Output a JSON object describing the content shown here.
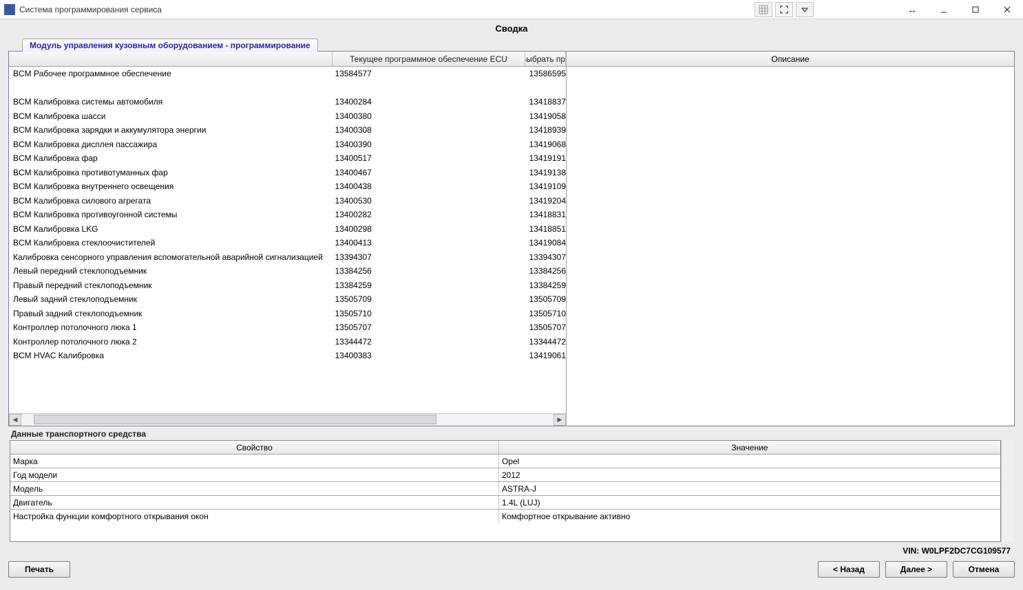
{
  "window": {
    "title": "Система программирования сервиса"
  },
  "page": {
    "summary_title": "Сводка"
  },
  "tab": {
    "label": "Модуль управления кузовным оборудованием - программирование"
  },
  "columns": {
    "blank": "",
    "current_ecu": "Текущее программное обеспечение ECU",
    "select_prog": "Выбрать про",
    "description": "Описание"
  },
  "rows": [
    {
      "name": "BCM Рабочее программное обеспечение",
      "cur": "13584577",
      "sel": "13586595"
    },
    {
      "name": "BCM Калибровка системы автомобиля",
      "cur": "13400284",
      "sel": "13418837"
    },
    {
      "name": "BCM Калибровка шасси",
      "cur": "13400380",
      "sel": "13419058"
    },
    {
      "name": "BCM Калибровка зарядки и аккумулятора энергии",
      "cur": "13400308",
      "sel": "13418939"
    },
    {
      "name": "BCM Калибровка дисплея пассажира",
      "cur": "13400390",
      "sel": "13419068"
    },
    {
      "name": "BCM Калибровка фар",
      "cur": "13400517",
      "sel": "13419191"
    },
    {
      "name": "BCM Калибровка противотуманных фар",
      "cur": "13400467",
      "sel": "13419138"
    },
    {
      "name": "BCM Калибровка внутреннего освещения",
      "cur": "13400438",
      "sel": "13419109"
    },
    {
      "name": "BCM Калибровка силового агрегата",
      "cur": "13400530",
      "sel": "13419204"
    },
    {
      "name": "BCM Калибровка противоугонной системы",
      "cur": "13400282",
      "sel": "13418831"
    },
    {
      "name": "BCM Калибровка LKG",
      "cur": "13400298",
      "sel": "13418851"
    },
    {
      "name": "BCM Калибровка стеклоочистителей",
      "cur": "13400413",
      "sel": "13419084"
    },
    {
      "name": "Калибровка сенсорного управления вспомогательной аварийной сигнализацией",
      "cur": "13394307",
      "sel": "13394307"
    },
    {
      "name": "Левый передний стеклоподъемник",
      "cur": "13384256",
      "sel": "13384256"
    },
    {
      "name": "Правый передний стеклоподъемник",
      "cur": "13384259",
      "sel": "13384259"
    },
    {
      "name": "Левый задний стеклоподъемник",
      "cur": "13505709",
      "sel": "13505709"
    },
    {
      "name": "Правый задний стеклоподъемник",
      "cur": "13505710",
      "sel": "13505710"
    },
    {
      "name": "Контроллер потолочного люка 1",
      "cur": "13505707",
      "sel": "13505707"
    },
    {
      "name": "Контроллер потолочного люка 2",
      "cur": "13344472",
      "sel": "13344472"
    },
    {
      "name": "BCM HVAC Калибровка",
      "cur": "13400383",
      "sel": "13419061"
    }
  ],
  "vehicle": {
    "section_title": "Данные транспортного средства",
    "headers": {
      "property": "Свойство",
      "value": "Значение"
    },
    "rows": [
      {
        "p": "Марка",
        "v": "Opel"
      },
      {
        "p": "Год модели",
        "v": "2012"
      },
      {
        "p": "Модель",
        "v": "ASTRA-J"
      },
      {
        "p": "Двигатель",
        "v": "1.4L (LUJ)"
      },
      {
        "p": "Настройка функции комфортного открывания окон",
        "v": "Комфортное открывание активно"
      }
    ]
  },
  "vin": {
    "label": "VIN: W0LPF2DC7CG109577"
  },
  "buttons": {
    "print": "Печать",
    "back": "< Назад",
    "next": "Далее >",
    "cancel": "Отмена"
  }
}
